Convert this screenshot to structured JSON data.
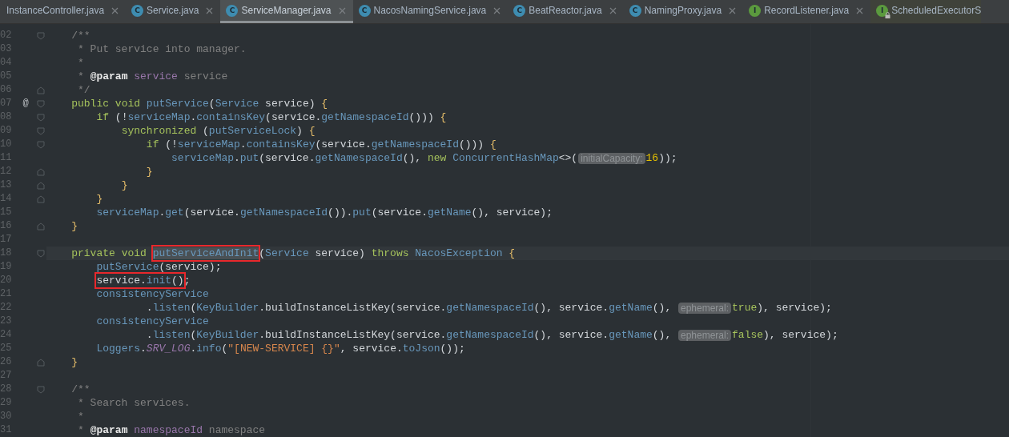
{
  "tabs": [
    {
      "label": "InstanceController.java",
      "selected": false,
      "close": true
    },
    {
      "label": "Service.java",
      "selected": false,
      "close": true,
      "icon": {
        "kind": "class",
        "letter": "C"
      }
    },
    {
      "label": "ServiceManager.java",
      "selected": true,
      "close": true,
      "icon": {
        "kind": "class",
        "letter": "C"
      }
    },
    {
      "label": "NacosNamingService.java",
      "selected": false,
      "close": true,
      "icon": {
        "kind": "class",
        "letter": "C"
      }
    },
    {
      "label": "BeatReactor.java",
      "selected": false,
      "close": true,
      "icon": {
        "kind": "class",
        "letter": "C"
      }
    },
    {
      "label": "NamingProxy.java",
      "selected": false,
      "close": true,
      "icon": {
        "kind": "class",
        "letter": "C"
      }
    },
    {
      "label": "RecordListener.java",
      "selected": false,
      "close": true,
      "icon": {
        "kind": "interface",
        "letter": "I"
      }
    },
    {
      "label": "ScheduledExecutorS",
      "selected": false,
      "close": false,
      "locked": true,
      "icon": {
        "kind": "interface",
        "letter": "I"
      }
    }
  ],
  "lines": [
    {
      "number": "02",
      "current": false,
      "fold": {
        "kind": "start"
      },
      "tokens": [
        {
          "kind": "cm",
          "text": "    /**"
        }
      ]
    },
    {
      "number": "03",
      "current": false,
      "tokens": [
        {
          "kind": "cm",
          "text": "     * Put service into manager."
        }
      ]
    },
    {
      "number": "04",
      "current": false,
      "tokens": [
        {
          "kind": "cm",
          "text": "     *"
        }
      ]
    },
    {
      "number": "05",
      "current": false,
      "tokens": [
        {
          "kind": "cm",
          "text": "     * "
        },
        {
          "kind": "tag",
          "text": "@param"
        },
        {
          "kind": "dparam",
          "text": " service"
        },
        {
          "kind": "cm",
          "text": " service"
        }
      ]
    },
    {
      "number": "06",
      "current": false,
      "fold": {
        "kind": "end"
      },
      "tokens": [
        {
          "kind": "cm",
          "text": "     */"
        }
      ]
    },
    {
      "number": "07",
      "current": false,
      "marker": "@",
      "fold": {
        "kind": "start"
      },
      "tokens": [
        {
          "kind": "kw",
          "text": "    public void "
        },
        {
          "kind": "fn",
          "text": "putService"
        },
        {
          "kind": "plain",
          "text": "("
        },
        {
          "kind": "type",
          "text": "Service"
        },
        {
          "kind": "plain",
          "text": " service) "
        },
        {
          "kind": "brace",
          "text": "{"
        }
      ]
    },
    {
      "number": "08",
      "current": false,
      "fold": {
        "kind": "start"
      },
      "tokens": [
        {
          "kind": "kw",
          "text": "        if"
        },
        {
          "kind": "plain",
          "text": " (!"
        },
        {
          "kind": "fn",
          "text": "serviceMap"
        },
        {
          "kind": "plain",
          "text": "."
        },
        {
          "kind": "fn",
          "text": "containsKey"
        },
        {
          "kind": "plain",
          "text": "(service."
        },
        {
          "kind": "fn",
          "text": "getNamespaceId"
        },
        {
          "kind": "plain",
          "text": "())) "
        },
        {
          "kind": "brace",
          "text": "{"
        }
      ]
    },
    {
      "number": "09",
      "current": false,
      "fold": {
        "kind": "start"
      },
      "tokens": [
        {
          "kind": "kw",
          "text": "            synchronized"
        },
        {
          "kind": "plain",
          "text": " ("
        },
        {
          "kind": "fn",
          "text": "putServiceLock"
        },
        {
          "kind": "plain",
          "text": ") "
        },
        {
          "kind": "brace",
          "text": "{"
        }
      ]
    },
    {
      "number": "10",
      "current": false,
      "fold": {
        "kind": "start"
      },
      "tokens": [
        {
          "kind": "kw",
          "text": "                if"
        },
        {
          "kind": "plain",
          "text": " (!"
        },
        {
          "kind": "fn",
          "text": "serviceMap"
        },
        {
          "kind": "plain",
          "text": "."
        },
        {
          "kind": "fn",
          "text": "containsKey"
        },
        {
          "kind": "plain",
          "text": "(service."
        },
        {
          "kind": "fn",
          "text": "getNamespaceId"
        },
        {
          "kind": "plain",
          "text": "())) "
        },
        {
          "kind": "brace",
          "text": "{"
        }
      ]
    },
    {
      "number": "11",
      "current": false,
      "tokens": [
        {
          "kind": "fn",
          "text": "                    serviceMap"
        },
        {
          "kind": "plain",
          "text": "."
        },
        {
          "kind": "fn",
          "text": "put"
        },
        {
          "kind": "plain",
          "text": "(service."
        },
        {
          "kind": "fn",
          "text": "getNamespaceId"
        },
        {
          "kind": "plain",
          "text": "(), "
        },
        {
          "kind": "kw",
          "text": "new "
        },
        {
          "kind": "type",
          "text": "ConcurrentHashMap"
        },
        {
          "kind": "plain",
          "text": "<>("
        },
        {
          "kind": "hint",
          "text": "initialCapacity:"
        },
        {
          "kind": "num",
          "text": "16"
        },
        {
          "kind": "plain",
          "text": "));"
        }
      ]
    },
    {
      "number": "12",
      "current": false,
      "fold": {
        "kind": "end"
      },
      "tokens": [
        {
          "kind": "brace",
          "text": "                }"
        }
      ]
    },
    {
      "number": "13",
      "current": false,
      "fold": {
        "kind": "end"
      },
      "tokens": [
        {
          "kind": "brace",
          "text": "            }"
        }
      ]
    },
    {
      "number": "14",
      "current": false,
      "fold": {
        "kind": "end"
      },
      "tokens": [
        {
          "kind": "brace",
          "text": "        }"
        }
      ]
    },
    {
      "number": "15",
      "current": false,
      "tokens": [
        {
          "kind": "fn",
          "text": "        serviceMap"
        },
        {
          "kind": "plain",
          "text": "."
        },
        {
          "kind": "fn",
          "text": "get"
        },
        {
          "kind": "plain",
          "text": "(service."
        },
        {
          "kind": "fn",
          "text": "getNamespaceId"
        },
        {
          "kind": "plain",
          "text": "())."
        },
        {
          "kind": "fn",
          "text": "put"
        },
        {
          "kind": "plain",
          "text": "(service."
        },
        {
          "kind": "fn",
          "text": "getName"
        },
        {
          "kind": "plain",
          "text": "(), service);"
        }
      ]
    },
    {
      "number": "16",
      "current": false,
      "fold": {
        "kind": "end"
      },
      "tokens": [
        {
          "kind": "brace",
          "text": "    }"
        }
      ]
    },
    {
      "number": "17",
      "current": false
    },
    {
      "number": "18",
      "current": true,
      "fold": {
        "kind": "start"
      },
      "tokens": [
        {
          "kind": "kw",
          "text": "    private void "
        },
        {
          "kind": "fn",
          "text": "putServiceAndInit",
          "boxed": true,
          "highlighted": true
        },
        {
          "kind": "plain",
          "text": "("
        },
        {
          "kind": "type",
          "text": "Service"
        },
        {
          "kind": "plain",
          "text": " service) "
        },
        {
          "kind": "kw",
          "text": "throws "
        },
        {
          "kind": "type",
          "text": "NacosException"
        },
        {
          "kind": "brace",
          "text": " {"
        }
      ]
    },
    {
      "number": "19",
      "current": false,
      "tokens": [
        {
          "kind": "fn",
          "text": "        putService"
        },
        {
          "kind": "plain",
          "text": "(service);"
        }
      ]
    },
    {
      "number": "20",
      "current": false,
      "tokens": [
        {
          "kind": "plain",
          "text": "        service.",
          "boxed": true
        },
        {
          "kind": "fn",
          "text": "init",
          "boxed": true
        },
        {
          "kind": "plain",
          "text": "()",
          "boxed": true
        },
        {
          "kind": "plain",
          "text": ";"
        }
      ]
    },
    {
      "number": "21",
      "current": false,
      "tokens": [
        {
          "kind": "fn",
          "text": "        consistencyService"
        }
      ]
    },
    {
      "number": "22",
      "current": false,
      "tokens": [
        {
          "kind": "plain",
          "text": "                ."
        },
        {
          "kind": "fn",
          "text": "listen"
        },
        {
          "kind": "plain",
          "text": "("
        },
        {
          "kind": "type",
          "text": "KeyBuilder"
        },
        {
          "kind": "plain",
          "text": ".buildInstanceListKey(service."
        },
        {
          "kind": "fn",
          "text": "getNamespaceId"
        },
        {
          "kind": "plain",
          "text": "(), service."
        },
        {
          "kind": "fn",
          "text": "getName"
        },
        {
          "kind": "plain",
          "text": "(), "
        },
        {
          "kind": "hint",
          "text": "ephemeral:"
        },
        {
          "kind": "kw",
          "text": "true"
        },
        {
          "kind": "plain",
          "text": "), service);"
        }
      ]
    },
    {
      "number": "23",
      "current": false,
      "tokens": [
        {
          "kind": "fn",
          "text": "        consistencyService"
        }
      ]
    },
    {
      "number": "24",
      "current": false,
      "tokens": [
        {
          "kind": "plain",
          "text": "                ."
        },
        {
          "kind": "fn",
          "text": "listen"
        },
        {
          "kind": "plain",
          "text": "("
        },
        {
          "kind": "type",
          "text": "KeyBuilder"
        },
        {
          "kind": "plain",
          "text": ".buildInstanceListKey(service."
        },
        {
          "kind": "fn",
          "text": "getNamespaceId"
        },
        {
          "kind": "plain",
          "text": "(), service."
        },
        {
          "kind": "fn",
          "text": "getName"
        },
        {
          "kind": "plain",
          "text": "(), "
        },
        {
          "kind": "hint",
          "text": "ephemeral:"
        },
        {
          "kind": "kw",
          "text": "false"
        },
        {
          "kind": "plain",
          "text": "), service);"
        }
      ]
    },
    {
      "number": "25",
      "current": false,
      "tokens": [
        {
          "kind": "type",
          "text": "        Loggers"
        },
        {
          "kind": "plain",
          "text": "."
        },
        {
          "kind": "field",
          "text": "SRV_LOG"
        },
        {
          "kind": "plain",
          "text": "."
        },
        {
          "kind": "fn",
          "text": "info"
        },
        {
          "kind": "plain",
          "text": "("
        },
        {
          "kind": "str",
          "text": "\"[NEW-SERVICE] {}\""
        },
        {
          "kind": "plain",
          "text": ", service."
        },
        {
          "kind": "fn",
          "text": "toJson"
        },
        {
          "kind": "plain",
          "text": "());"
        }
      ]
    },
    {
      "number": "26",
      "current": false,
      "fold": {
        "kind": "end"
      },
      "tokens": [
        {
          "kind": "brace",
          "text": "    }"
        }
      ]
    },
    {
      "number": "27",
      "current": false
    },
    {
      "number": "28",
      "current": false,
      "fold": {
        "kind": "start"
      },
      "tokens": [
        {
          "kind": "cm",
          "text": "    /**"
        }
      ]
    },
    {
      "number": "29",
      "current": false,
      "tokens": [
        {
          "kind": "cm",
          "text": "     * Search services."
        }
      ]
    },
    {
      "number": "30",
      "current": false,
      "tokens": [
        {
          "kind": "cm",
          "text": "     *"
        }
      ]
    },
    {
      "number": "31",
      "current": false,
      "tokens": [
        {
          "kind": "cm",
          "text": "     * "
        },
        {
          "kind": "tag",
          "text": "@param"
        },
        {
          "kind": "dparam",
          "text": " namespaceId"
        },
        {
          "kind": "cm",
          "text": " namespace"
        }
      ]
    }
  ]
}
